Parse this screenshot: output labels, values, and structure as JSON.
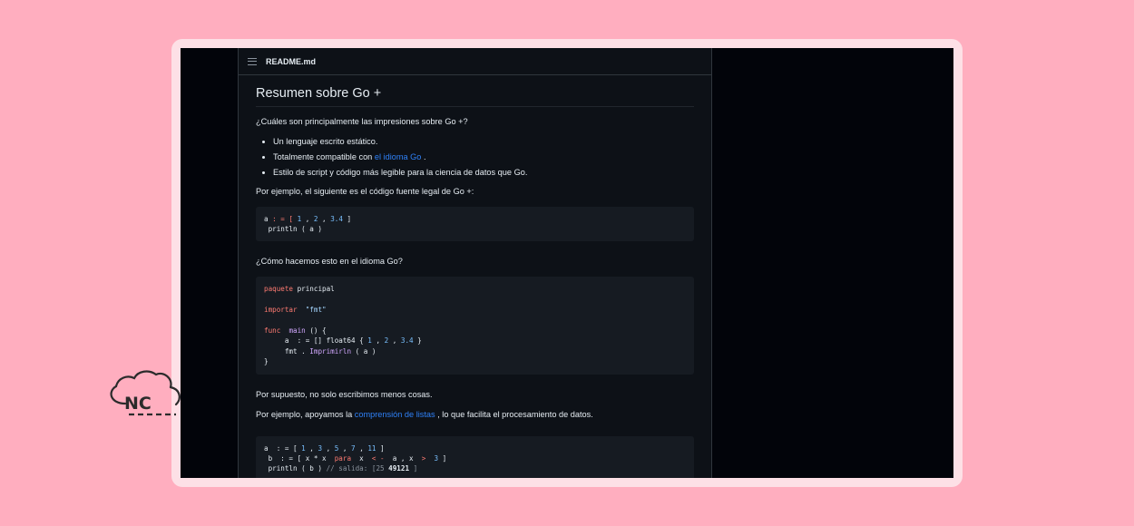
{
  "readme": {
    "filename": "README.md",
    "heading": "Resumen sobre Go +",
    "intro": "¿Cuáles son principalmente las impresiones sobre Go +?",
    "bullets": [
      {
        "text": "Un lenguaje escrito estático."
      },
      {
        "text_before": "Totalmente compatible con ",
        "link": "el idioma Go",
        "text_after": " ."
      },
      {
        "text": "Estilo de script y código más legible para la ciencia de datos que Go."
      }
    ],
    "para_example": "Por ejemplo, el siguiente es el código fuente legal de Go +:",
    "code1": {
      "l1": {
        "a": "a",
        "op": " : = [ ",
        "n1": "1",
        "c1": " , ",
        "n2": "2",
        "c2": " , ",
        "n3": "3.4",
        "end": " ]"
      },
      "l2": " println ( a )"
    },
    "para_how": "¿Cómo hacemos esto en el idioma Go?",
    "code2": {
      "kw_package": "paquete",
      "package_name": " principal",
      "kw_import": "importar",
      "import_str": "\"fmt\"",
      "kw_func": "func",
      "fn_main": "main",
      "main_rest": " () {",
      "decl": "     a  : = [] float64 { ",
      "n1": "1",
      "c1": " , ",
      "n2": "2",
      "c2": " , ",
      "n3": "3.4",
      "end": " }",
      "call_pre": "     fmt . ",
      "call_fn": "Imprimirln",
      "call_args": " ( a )",
      "close": "}"
    },
    "para_less": "Por supuesto, no solo escribimos menos cosas.",
    "para_list_before": "Por ejemplo, apoyamos la ",
    "para_list_link": "comprensión de listas",
    "para_list_after": " , lo que facilita el procesamiento de datos.",
    "code3": {
      "l1_pre": "a  : = [ ",
      "v1": "1",
      "v2": "3",
      "v3": "5",
      "v4": "7",
      "v5": "11",
      "sep": " , ",
      "l1_end": " ]",
      "l2_pre": " b  : = [ x * x  ",
      "kw_para": "para",
      "l2_mid": "  x  ",
      "arrow": "< -",
      "l2_mid2": "  a , x  ",
      "gt": ">",
      "l2_sp": "  ",
      "three": "3",
      "l2_end": " ]",
      "l3_pre": " println ( b ) ",
      "comment": "// salida: [25 ",
      "bold_out": "49121",
      "comment_end": " ]"
    }
  },
  "logo": {
    "text": "NC",
    "icon": "cloud-icon"
  }
}
